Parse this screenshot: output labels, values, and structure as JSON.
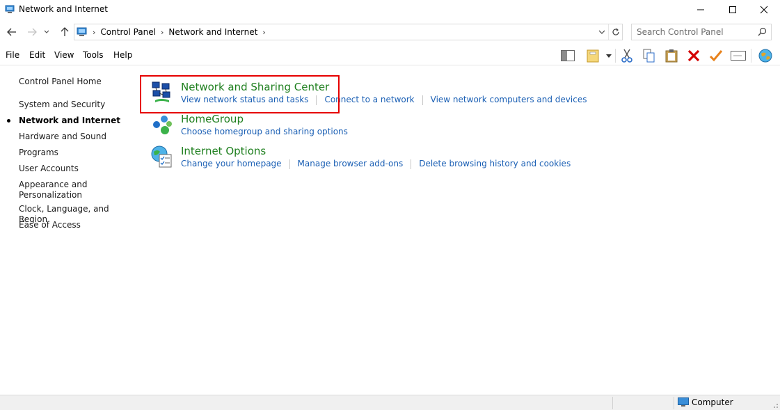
{
  "window": {
    "title": "Network and Internet"
  },
  "address": {
    "crumbs": [
      "Control Panel",
      "Network and Internet"
    ]
  },
  "search": {
    "placeholder": "Search Control Panel"
  },
  "menu": {
    "items": [
      "File",
      "Edit",
      "View",
      "Tools",
      "Help"
    ]
  },
  "sidebar": {
    "items": [
      {
        "label": "Control Panel Home"
      },
      {
        "label": "System and Security"
      },
      {
        "label": "Network and Internet",
        "active": true
      },
      {
        "label": "Hardware and Sound"
      },
      {
        "label": "Programs"
      },
      {
        "label": "User Accounts"
      },
      {
        "label": "Appearance and Personalization"
      },
      {
        "label": "Clock, Language, and Region"
      },
      {
        "label": "Ease of Access"
      }
    ]
  },
  "categories": [
    {
      "title": "Network and Sharing Center",
      "icon": "network-sharing-icon",
      "tasks": [
        "View network status and tasks",
        "Connect to a network",
        "View network computers and devices"
      ]
    },
    {
      "title": "HomeGroup",
      "icon": "homegroup-icon",
      "tasks": [
        "Choose homegroup and sharing options"
      ]
    },
    {
      "title": "Internet Options",
      "icon": "internet-options-icon",
      "tasks": [
        "Change your homepage",
        "Manage browser add-ons",
        "Delete browsing history and cookies"
      ]
    }
  ],
  "status": {
    "location": "Computer"
  },
  "colors": {
    "category_title": "#1e7f1e",
    "task_link": "#1a5fb4",
    "highlight": "#e60000"
  }
}
